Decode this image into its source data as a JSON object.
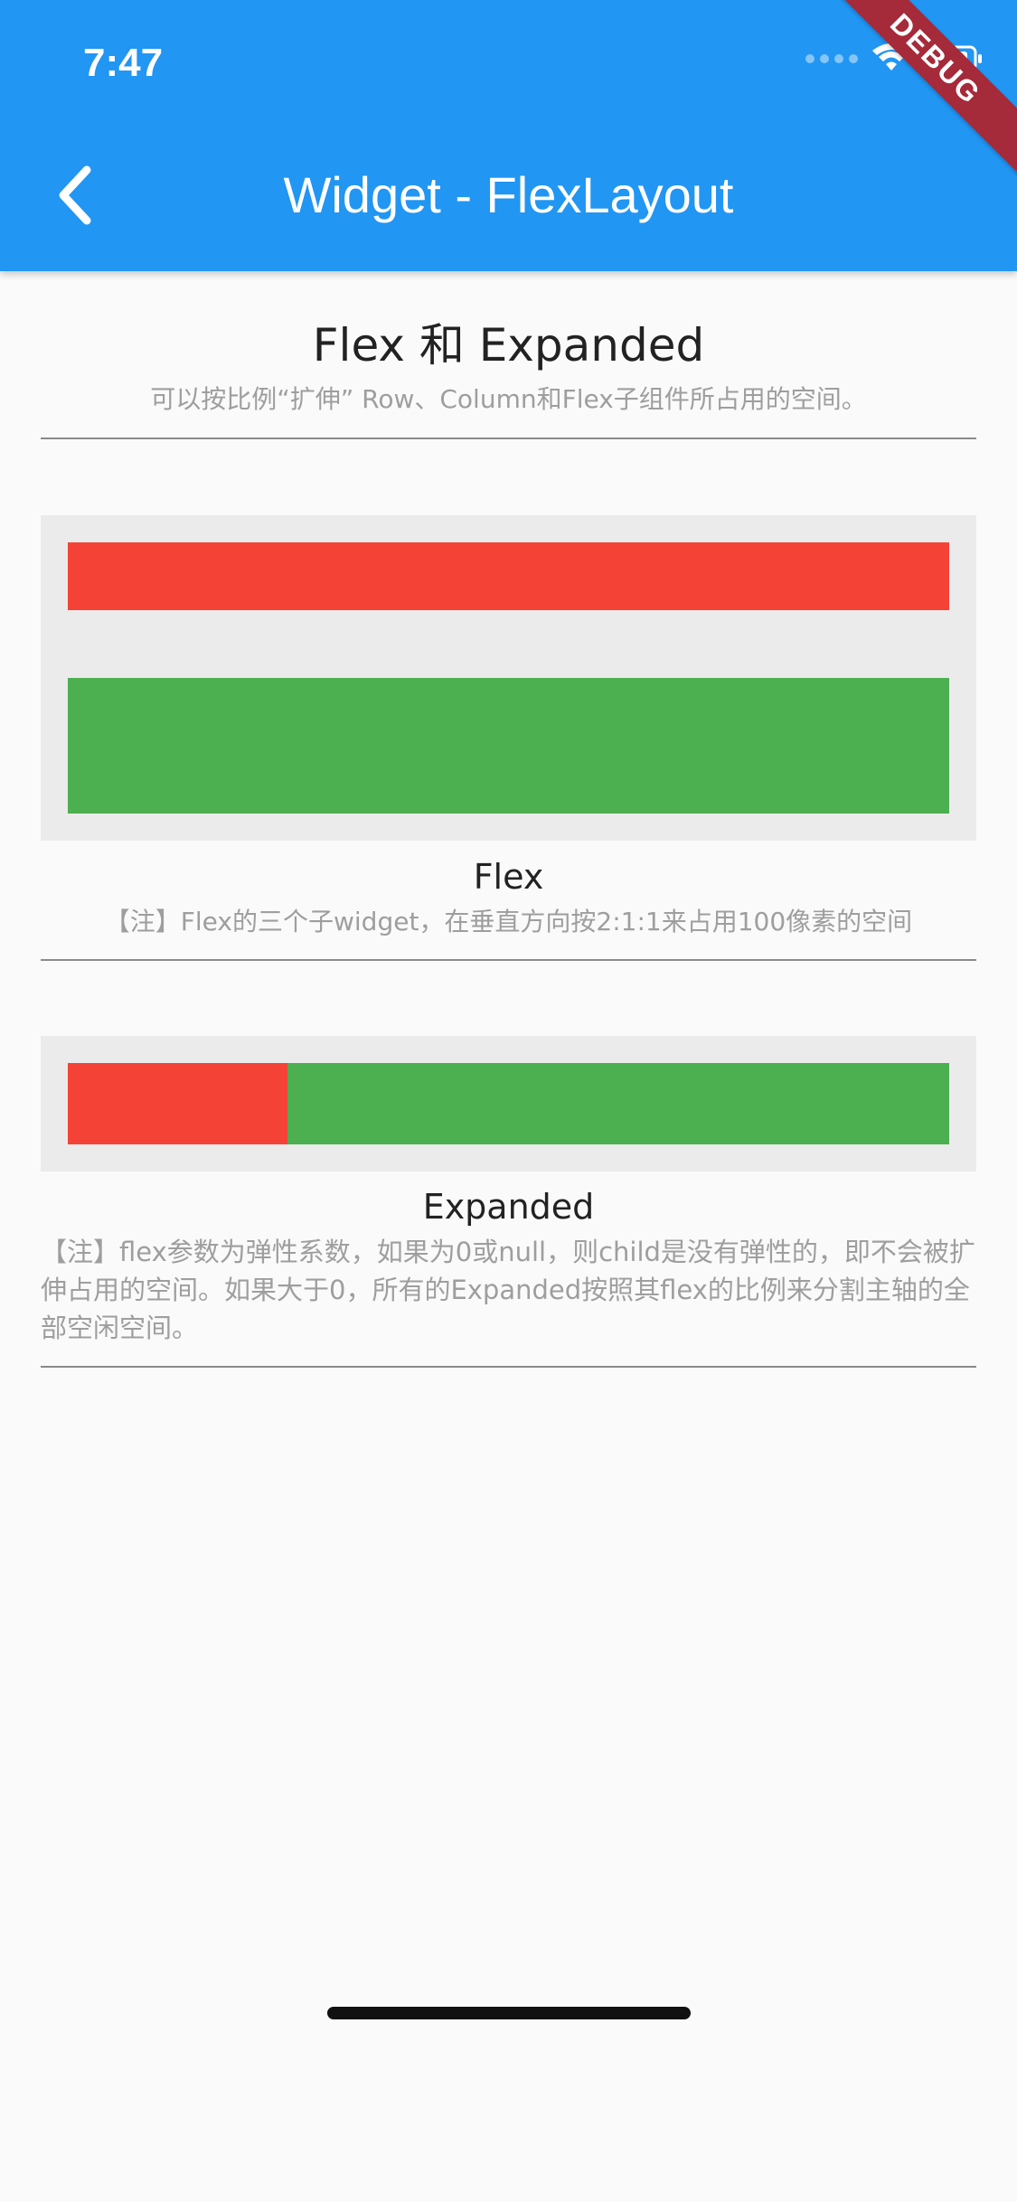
{
  "status_bar": {
    "time": "7:47"
  },
  "app_bar": {
    "title": "Widget - FlexLayout",
    "back_icon": "chevron-left-icon",
    "debug_label": "DEBUG",
    "background_color": "#2196F3"
  },
  "header": {
    "title": "Flex 和 Expanded",
    "subtitle": "可以按比例“扩伸” Row、Column和Flex子组件所占用的空间。"
  },
  "flex_demo": {
    "title": "Flex",
    "note": "【注】Flex的三个子widget，在垂直方向按2:1:1来占用100像素的空间",
    "children": [
      {
        "name": "red",
        "flex": 1,
        "color": "#F44336"
      },
      {
        "name": "gap",
        "flex": 1,
        "color": "#EBEBEB"
      },
      {
        "name": "green",
        "flex": 2,
        "color": "#4CAF50"
      }
    ]
  },
  "expanded_demo": {
    "title": "Expanded",
    "note": "【注】flex参数为弹性系数，如果为0或null，则child是没有弹性的，即不会被扩伸占用的空间。如果大于0，所有的Expanded按照其flex的比例来分割主轴的全部空闲空间。",
    "children": [
      {
        "name": "red",
        "flex": 1,
        "color": "#F44336"
      },
      {
        "name": "green",
        "flex": 3,
        "color": "#4CAF50"
      }
    ]
  }
}
